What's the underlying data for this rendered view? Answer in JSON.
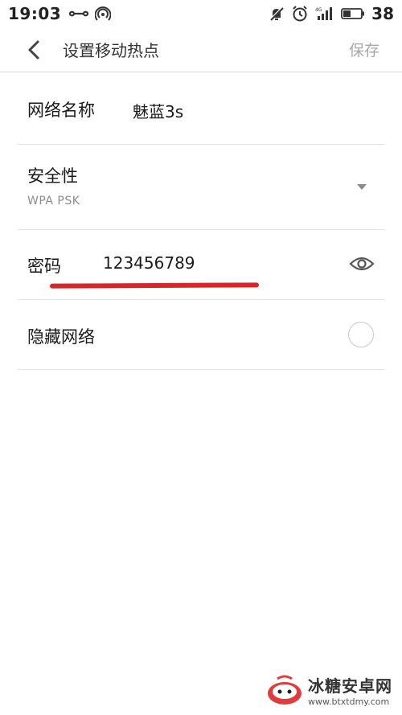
{
  "status_bar": {
    "time": "19:03",
    "battery": "38",
    "icons": [
      "infinity-icon",
      "hotspot-icon",
      "mute-icon",
      "alarm-icon",
      "signal-4g-icon",
      "battery-icon"
    ]
  },
  "header": {
    "title": "设置移动热点",
    "save_label": "保存"
  },
  "form": {
    "network_name": {
      "label": "网络名称",
      "value": "魅蓝3s"
    },
    "security": {
      "label": "安全性",
      "value": "WPA PSK"
    },
    "password": {
      "label": "密码",
      "value": "123456789"
    },
    "hidden_network": {
      "label": "隐藏网络",
      "checked": false
    }
  },
  "colors": {
    "annotation_underline": "#d7262b",
    "save_disabled": "#a8a8a8"
  },
  "watermark": {
    "title": "冰糖安卓网",
    "url": "www.btxtdmy.com"
  }
}
